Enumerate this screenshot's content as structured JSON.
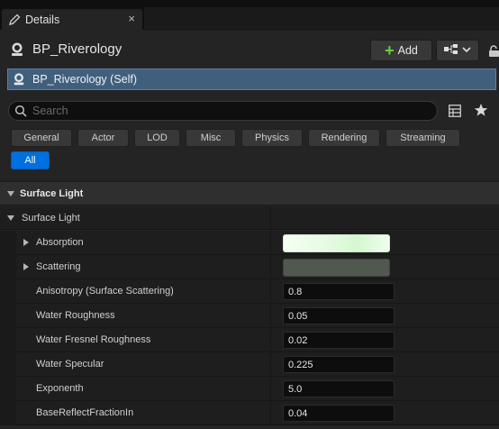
{
  "tab": {
    "label": "Details",
    "close": "×"
  },
  "actor": {
    "name": "BP_Riverology",
    "add_label": "Add"
  },
  "self_row": {
    "label": "BP_Riverology (Self)"
  },
  "search": {
    "placeholder": "Search"
  },
  "filters": [
    {
      "label": "General"
    },
    {
      "label": "Actor"
    },
    {
      "label": "LOD"
    },
    {
      "label": "Misc"
    },
    {
      "label": "Physics"
    },
    {
      "label": "Rendering"
    },
    {
      "label": "Streaming"
    },
    {
      "label": "All",
      "active": true
    }
  ],
  "section": {
    "title": "Surface Light"
  },
  "category": {
    "title": "Surface Light"
  },
  "properties": [
    {
      "name": "Absorption",
      "kind": "color",
      "expandable": true,
      "color": "#e6fbe4"
    },
    {
      "name": "Scattering",
      "kind": "color",
      "expandable": true,
      "color": "#505850"
    },
    {
      "name": "Anisotropy (Surface Scattering)",
      "value": "0.8"
    },
    {
      "name": "Water Roughness",
      "value": "0.05"
    },
    {
      "name": "Water Fresnel Roughness",
      "value": "0.02"
    },
    {
      "name": "Water Specular",
      "value": "0.225"
    },
    {
      "name": "Exponenth",
      "value": "5.0"
    },
    {
      "name": "BaseReflectFractionIn",
      "value": "0.04"
    }
  ]
}
